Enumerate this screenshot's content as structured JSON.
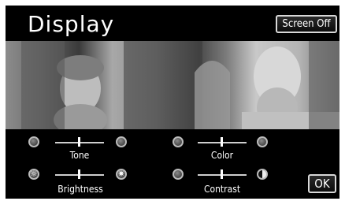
{
  "header": {
    "title": "Display",
    "screen_off_label": "Screen Off"
  },
  "controls": {
    "tone_label": "Tone",
    "color_label": "Color",
    "brightness_label": "Brightness",
    "contrast_label": "Contrast"
  },
  "footer": {
    "ok_label": "OK"
  }
}
